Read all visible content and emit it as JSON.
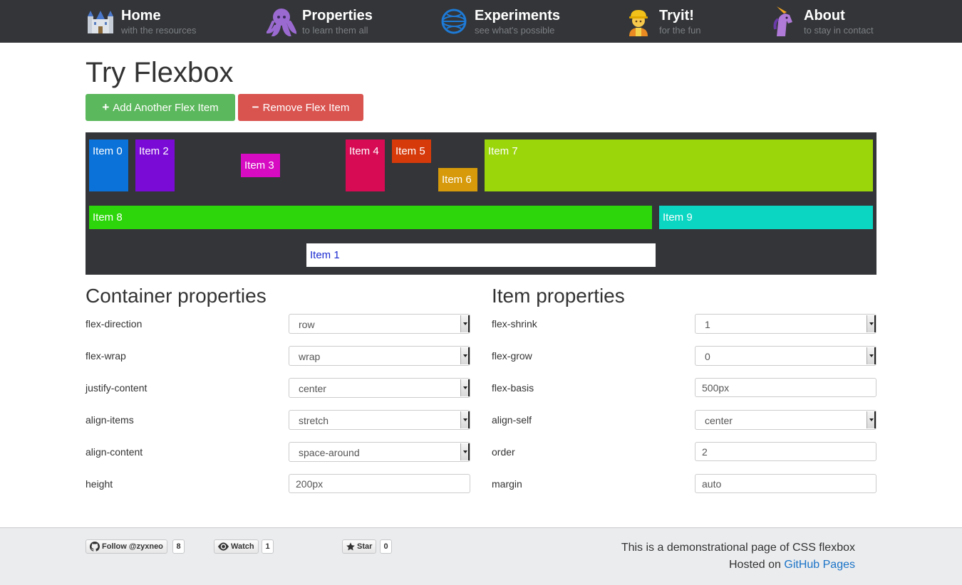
{
  "nav": {
    "items": [
      {
        "icon": "castle-icon",
        "title": "Home",
        "subtitle": "with the resources"
      },
      {
        "icon": "octopus-icon",
        "title": "Properties",
        "subtitle": "to learn them all"
      },
      {
        "icon": "globe-icon",
        "title": "Experiments",
        "subtitle": "see what's possible"
      },
      {
        "icon": "construction-worker-icon",
        "title": "Tryit!",
        "subtitle": "for the fun"
      },
      {
        "icon": "unicorn-icon",
        "title": "About",
        "subtitle": "to stay in contact"
      }
    ]
  },
  "page": {
    "title": "Try Flexbox",
    "add_button": {
      "glyph": "+",
      "label": "Add Another Flex Item"
    },
    "remove_button": {
      "glyph": "−",
      "label": "Remove Flex Item"
    }
  },
  "flex_items": [
    {
      "label": "Item 0",
      "color": "#0a72d9"
    },
    {
      "label": "Item 2",
      "color": "#7a0bd6"
    },
    {
      "label": "Item 3",
      "color": "#d60bc2"
    },
    {
      "label": "Item 4",
      "color": "#d60b54"
    },
    {
      "label": "Item 5",
      "color": "#d63a0b"
    },
    {
      "label": "Item 6",
      "color": "#d69a0b"
    },
    {
      "label": "Item 7",
      "color": "#9bd60b"
    },
    {
      "label": "Item 8",
      "color": "#2dd60b"
    },
    {
      "label": "Item 9",
      "color": "#0bd6c2"
    },
    {
      "label": "Item 1",
      "color": "#ffffff",
      "text_color": "#1a2ad0"
    }
  ],
  "container_properties": {
    "title": "Container properties",
    "rows": [
      {
        "label": "flex-direction",
        "value": "row",
        "type": "select"
      },
      {
        "label": "flex-wrap",
        "value": "wrap",
        "type": "select"
      },
      {
        "label": "justify-content",
        "value": "center",
        "type": "select"
      },
      {
        "label": "align-items",
        "value": "stretch",
        "type": "select"
      },
      {
        "label": "align-content",
        "value": "space-around",
        "type": "select"
      },
      {
        "label": "height",
        "value": "200px",
        "type": "input"
      }
    ]
  },
  "item_properties": {
    "title": "Item properties",
    "rows": [
      {
        "label": "flex-shrink",
        "value": "1",
        "type": "select"
      },
      {
        "label": "flex-grow",
        "value": "0",
        "type": "select"
      },
      {
        "label": "flex-basis",
        "value": "500px",
        "type": "input"
      },
      {
        "label": "align-self",
        "value": "center",
        "type": "select"
      },
      {
        "label": "order",
        "value": "2",
        "type": "input"
      },
      {
        "label": "margin",
        "value": "auto",
        "type": "input"
      }
    ]
  },
  "footer": {
    "github": [
      {
        "icon": "github-icon",
        "label": "Follow @zyxneo",
        "count": "8"
      },
      {
        "icon": "eye-icon",
        "label": "Watch",
        "count": "1"
      },
      {
        "icon": "star-icon",
        "label": "Star",
        "count": "0"
      }
    ],
    "line1": "This is a demonstrational page of CSS flexbox",
    "line2_prefix": "Hosted on ",
    "line2_link": "GitHub Pages"
  }
}
